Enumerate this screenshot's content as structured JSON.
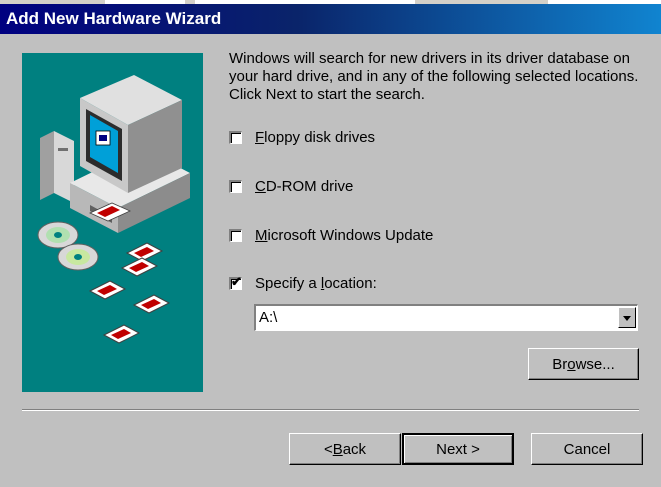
{
  "window": {
    "title": "Add New Hardware Wizard"
  },
  "intro": {
    "text": "Windows will search for new drivers in its driver database on your hard drive, and in any of the following selected locations. Click Next to start the search."
  },
  "options": [
    {
      "pre": "",
      "accel": "F",
      "post": "loppy disk drives",
      "checked": false
    },
    {
      "pre": "",
      "accel": "C",
      "post": "D-ROM drive",
      "checked": false
    },
    {
      "pre": "",
      "accel": "M",
      "post": "icrosoft Windows Update",
      "checked": false
    },
    {
      "pre": "Specify a ",
      "accel": "l",
      "post": "ocation:",
      "checked": true
    }
  ],
  "location": {
    "value": "A:\\"
  },
  "buttons": {
    "browse_pre": "Br",
    "browse_accel": "o",
    "browse_post": "wse...",
    "back_pre": "< ",
    "back_accel": "B",
    "back_post": "ack",
    "next": "Next >",
    "cancel": "Cancel"
  },
  "colors": {
    "title_start": "#000080",
    "title_end": "#1084d0",
    "illustration_bg": "#008080",
    "face": "#c0c0c0"
  },
  "icons": [
    "computer-icon",
    "cd-icon",
    "floppy-disk-icon",
    "dropdown-arrow-icon"
  ]
}
